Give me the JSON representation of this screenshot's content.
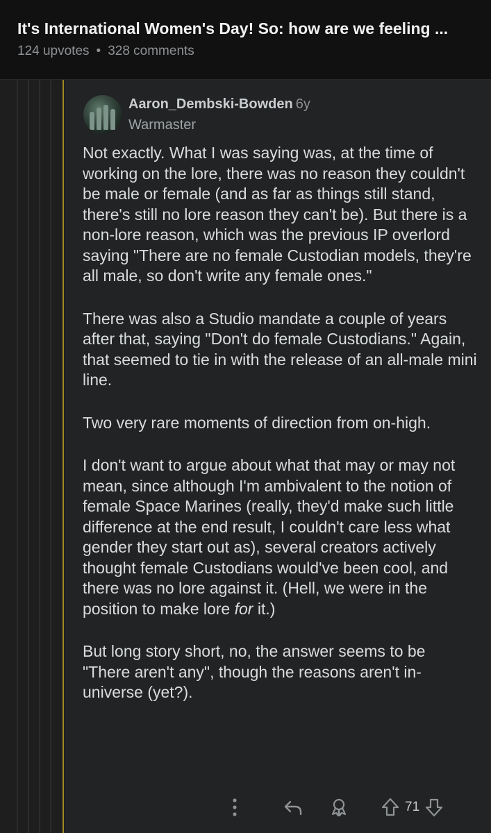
{
  "header": {
    "title": "It's International Women's Day! So: how are we feeling ...",
    "upvotes": "124 upvotes",
    "separator": "•",
    "comments": "328 comments"
  },
  "comment": {
    "author": "Aaron_Dembski-Bowden",
    "age": "6y",
    "flair": "Warmaster",
    "paragraphs": [
      "Not exactly. What I was saying was, at the time of working on the lore, there was no reason they couldn't be male or female (and as far as things still stand, there's still no lore reason they can't be). But there is a non-lore reason, which was the previous IP overlord saying \"There are no female Custodian models, they're all male, so don't write any female ones.\"",
      "There was also a Studio mandate a couple of years after that, saying \"Don't do female Custodians.\" Again, that seemed to tie in with the release of an all-male mini line.",
      "Two very rare moments of direction from on-high.",
      "I don't want to argue about what that may or may not mean, since although I'm ambivalent to the notion of female Space Marines (really, they'd make such little difference at the end result, I couldn't care less what gender they start out as), several creators actively thought female Custodians would've been cool, and there was no lore against it. (Hell, we were in the position to make lore ",
      "But long story short, no, the answer seems to be \"There aren't any\", though the reasons aren't in-universe (yet?)."
    ],
    "p4_emphasis": "for",
    "p4_tail": " it.)",
    "score": "71"
  },
  "icons": {
    "more": "more-options-icon",
    "reply": "reply-icon",
    "award": "award-icon",
    "upvote": "upvote-arrow-icon",
    "downvote": "downvote-arrow-icon"
  },
  "colors": {
    "header_bg": "#111111",
    "comment_bg": "#222324",
    "thread_accent": "#a08823",
    "text": "#d9dcde",
    "muted": "#8e9295"
  }
}
